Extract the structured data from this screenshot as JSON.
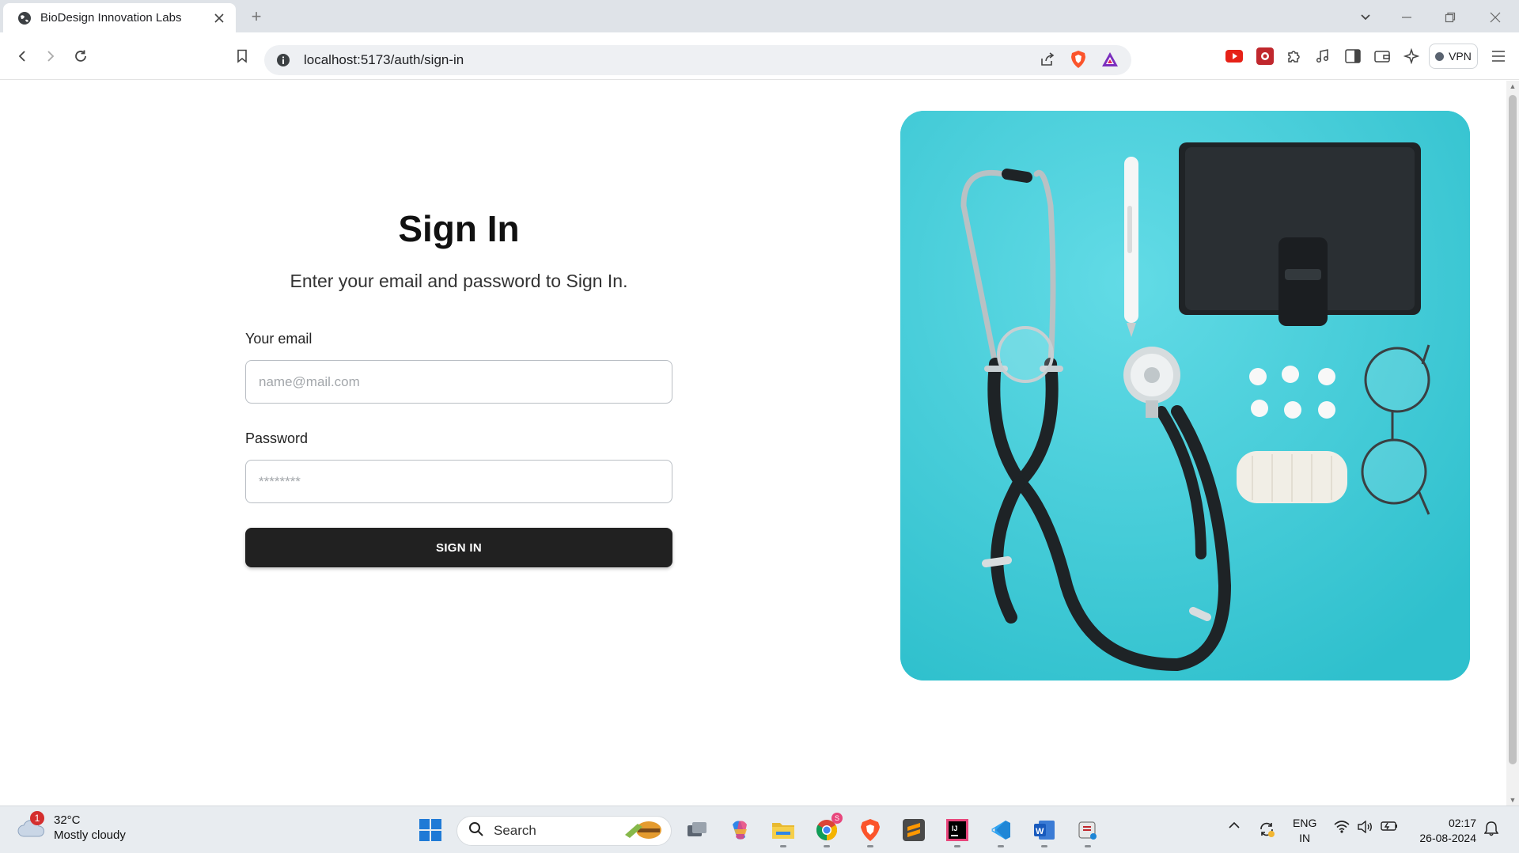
{
  "browser": {
    "tab_title": "BioDesign Innovation Labs",
    "new_tab_symbol": "+",
    "url": "localhost:5173/auth/sign-in",
    "vpn_label": "VPN"
  },
  "page": {
    "title": "Sign In",
    "subtitle": "Enter your email and password to Sign In.",
    "email_label": "Your email",
    "email_placeholder": "name@mail.com",
    "email_value": "",
    "password_label": "Password",
    "password_placeholder": "********",
    "password_value": "",
    "submit_label": "SIGN IN",
    "hero_image": "stethoscope-medical-flatlay"
  },
  "taskbar": {
    "weather_temp": "32°C",
    "weather_desc": "Mostly cloudy",
    "weather_badge": "1",
    "search_placeholder": "Search",
    "chrome_badge": "S",
    "lang_top": "ENG",
    "lang_bottom": "IN",
    "time": "02:17",
    "date": "26-08-2024"
  },
  "colors": {
    "primary_button": "#212121",
    "hero_background": "#40c9d6",
    "brave_orange": "#fb542b"
  }
}
